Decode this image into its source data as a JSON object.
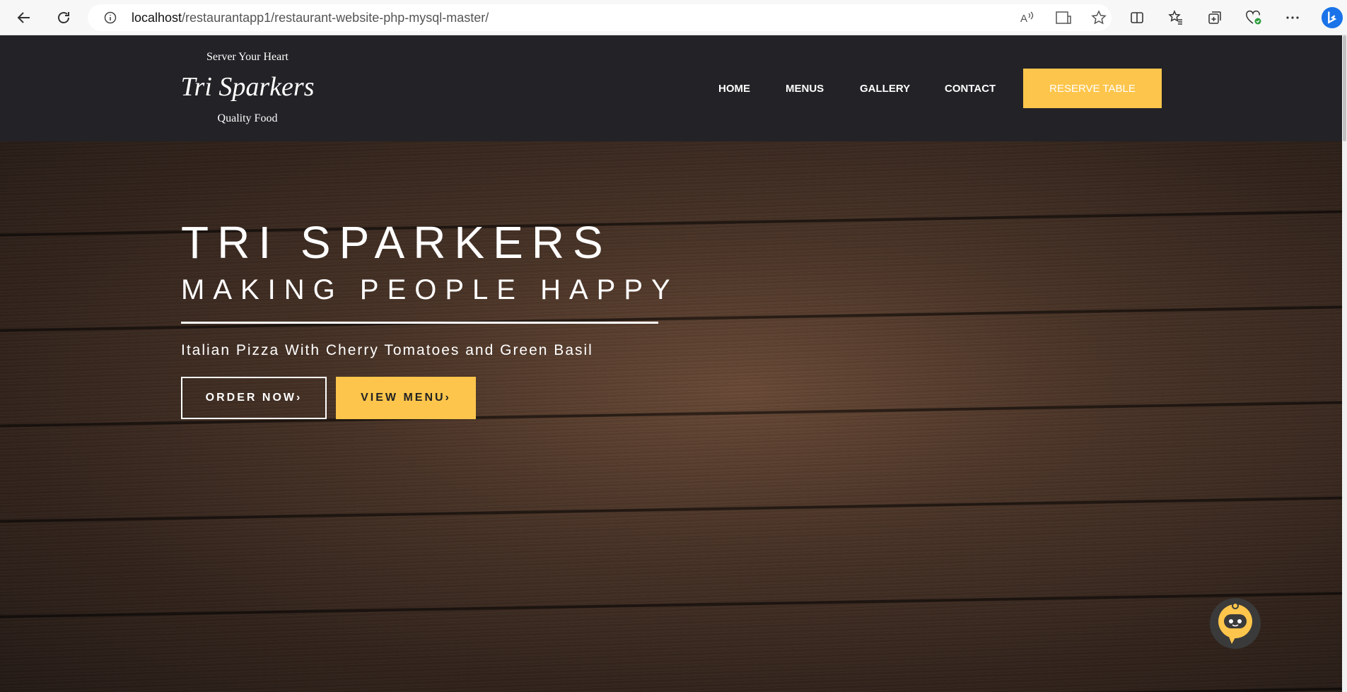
{
  "browser": {
    "url_host": "localhost",
    "url_path": "/restaurantapp1/restaurant-website-php-mysql-master/"
  },
  "logo": {
    "top_text": "Server Your Heart",
    "main_text": "Tri Sparkers",
    "bottom_text": "Quality Food"
  },
  "nav": {
    "items": [
      {
        "label": "HOME"
      },
      {
        "label": "MENUS"
      },
      {
        "label": "GALLERY"
      },
      {
        "label": "CONTACT"
      }
    ],
    "reserve_label": "RESERVE TABLE"
  },
  "hero": {
    "title": "TRI SPARKERS",
    "subtitle": "MAKING PEOPLE HAPPY",
    "caption": "Italian Pizza With Cherry Tomatoes and Green Basil",
    "order_label": "ORDER NOW›",
    "menu_label": "VIEW MENU›"
  },
  "colors": {
    "header_bg": "#222227",
    "accent": "#fdc54b"
  },
  "icons": [
    "back-icon",
    "refresh-icon",
    "info-icon",
    "read-aloud-icon",
    "immersive-reader-icon",
    "favorite-star-icon",
    "split-screen-icon",
    "favorites-icon",
    "collections-icon",
    "browser-essentials-icon",
    "more-icon",
    "bing-icon",
    "chatbot-icon"
  ]
}
